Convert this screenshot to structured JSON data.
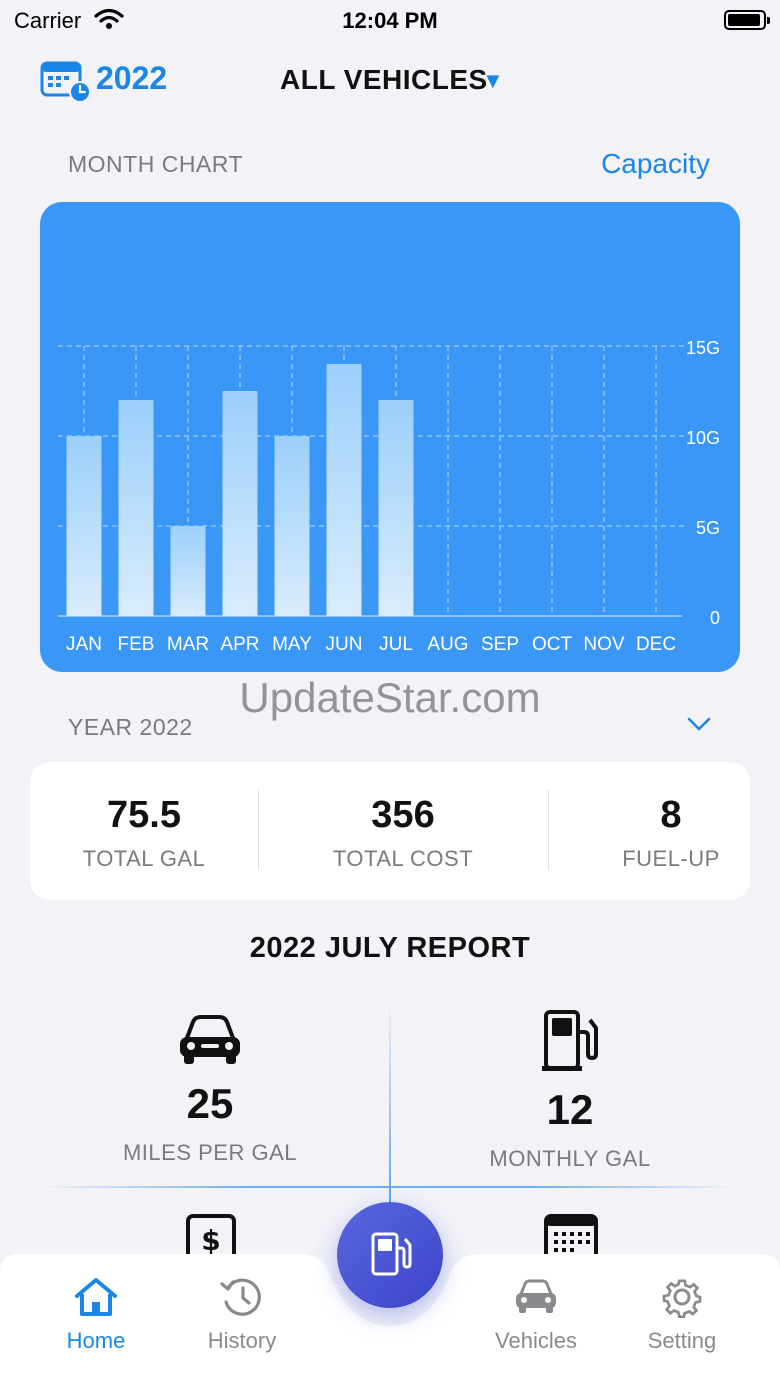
{
  "status_bar": {
    "carrier": "Carrier",
    "time": "12:04 PM"
  },
  "header": {
    "year": "2022",
    "vehicle_filter": "ALL VEHICLES"
  },
  "month_chart": {
    "label": "MONTH CHART",
    "mode_link": "Capacity"
  },
  "chart_data": {
    "type": "bar",
    "categories": [
      "JAN",
      "FEB",
      "MAR",
      "APR",
      "MAY",
      "JUN",
      "JUL",
      "AUG",
      "SEP",
      "OCT",
      "NOV",
      "DEC"
    ],
    "values": [
      10,
      12,
      5,
      12.5,
      10,
      14,
      12,
      0,
      0,
      0,
      0,
      0
    ],
    "yticks": [
      "0",
      "5G",
      "10G",
      "15G"
    ],
    "ylim": [
      0,
      15
    ],
    "grid": true,
    "colors": {
      "background": "#3a97f5",
      "bar": "#b9dcfb",
      "grid": "#8cc3fa"
    }
  },
  "year_section": {
    "label": "YEAR 2022"
  },
  "year_stats": [
    {
      "value": "75.5",
      "label": "TOTAL GAL"
    },
    {
      "value": "356",
      "label": "TOTAL COST"
    },
    {
      "value": "8",
      "label": "FUEL-UP"
    }
  ],
  "report": {
    "title": "2022 JULY REPORT",
    "metrics": [
      {
        "icon": "car-icon",
        "value": "25",
        "label": "MILES PER GAL"
      },
      {
        "icon": "fuel-pump-icon",
        "value": "12",
        "label": "MONTHLY GAL"
      },
      {
        "icon": "dollar-icon"
      },
      {
        "icon": "calendar-icon"
      }
    ]
  },
  "watermark": "UpdateStar.com",
  "tabbar": {
    "items": [
      {
        "label": "Home",
        "icon": "home-icon",
        "active": true
      },
      {
        "label": "History",
        "icon": "history-icon",
        "active": false
      },
      {
        "label": "Vehicles",
        "icon": "car-icon",
        "active": false
      },
      {
        "label": "Setting",
        "icon": "gear-icon",
        "active": false
      }
    ],
    "fab_icon": "fuel-pump-icon"
  },
  "colors": {
    "accent": "#1a86e8",
    "fab": "#4552d6"
  }
}
